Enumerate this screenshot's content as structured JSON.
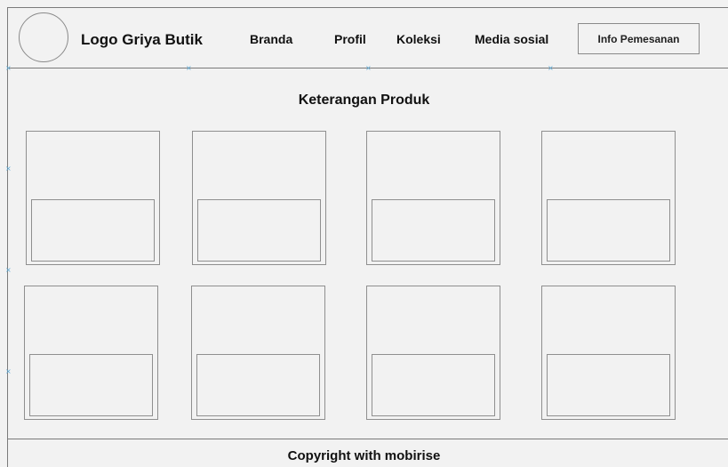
{
  "header": {
    "logo_text": "Logo Griya Butik",
    "nav": [
      {
        "label": "Branda"
      },
      {
        "label": "Profil"
      },
      {
        "label": "Koleksi"
      },
      {
        "label": "Media sosial"
      }
    ],
    "order_button": "Info Pemesanan"
  },
  "main": {
    "section_title": "Keterangan Produk",
    "cards_count": 8
  },
  "footer": {
    "copyright": "Copyright with mobirise"
  },
  "colors": {
    "background": "#f2f2f2",
    "border": "#8f8f8f",
    "marker": "#5aa9d6"
  }
}
